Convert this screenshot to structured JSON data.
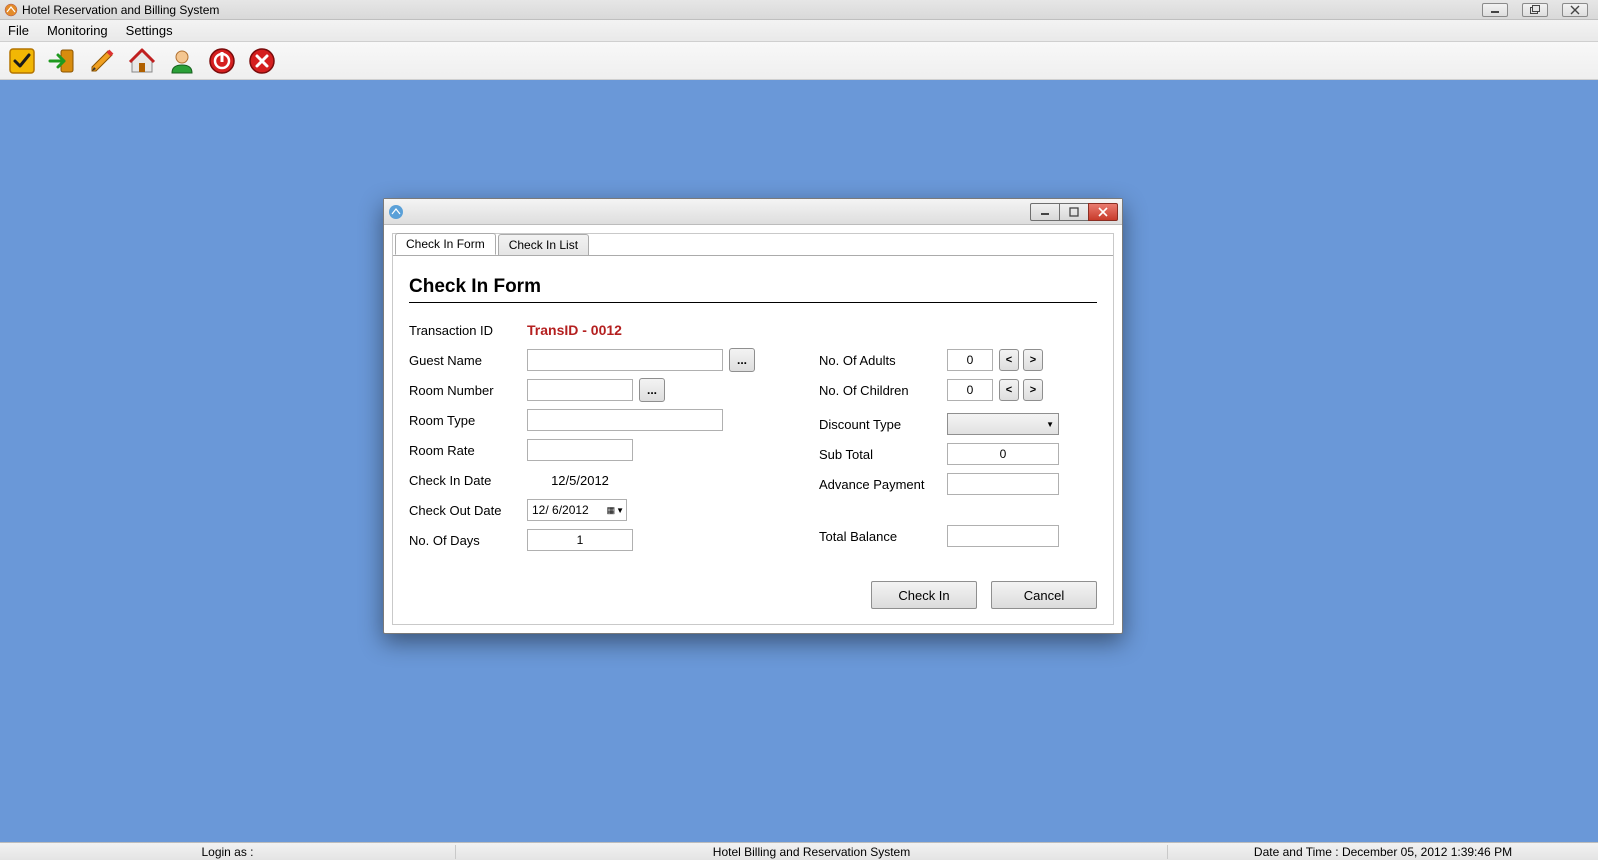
{
  "app": {
    "title": "Hotel Reservation and Billing System"
  },
  "menu": {
    "file": "File",
    "monitoring": "Monitoring",
    "settings": "Settings"
  },
  "dialog": {
    "tabs": {
      "form": "Check In Form",
      "list": "Check In List"
    },
    "heading": "Check In Form",
    "labels": {
      "transactionId": "Transaction ID",
      "guestName": "Guest Name",
      "roomNumber": "Room Number",
      "roomType": "Room Type",
      "roomRate": "Room Rate",
      "checkInDate": "Check In Date",
      "checkOutDate": "Check Out Date",
      "noOfDays": "No. Of Days",
      "noOfAdults": "No. Of Adults",
      "noOfChildren": "No. Of Children",
      "discountType": "Discount Type",
      "subTotal": "Sub Total",
      "advancePayment": "Advance Payment",
      "totalBalance": "Total Balance"
    },
    "values": {
      "transactionId": "TransID - 0012",
      "guestName": "",
      "roomNumber": "",
      "roomType": "",
      "roomRate": "",
      "checkInDate": "12/5/2012",
      "checkOutDate": "12/  6/2012",
      "noOfDays": "1",
      "noOfAdults": "0",
      "noOfChildren": "0",
      "discountType": "",
      "subTotal": "0",
      "advancePayment": "",
      "totalBalance": ""
    },
    "buttons": {
      "browse": "...",
      "decrement": "<",
      "increment": ">",
      "checkIn": "Check In",
      "cancel": "Cancel"
    }
  },
  "statusbar": {
    "login": "Login as :",
    "title": "Hotel Billing and Reservation System",
    "datetime": "Date and Time : December 05, 2012 1:39:46 PM"
  }
}
